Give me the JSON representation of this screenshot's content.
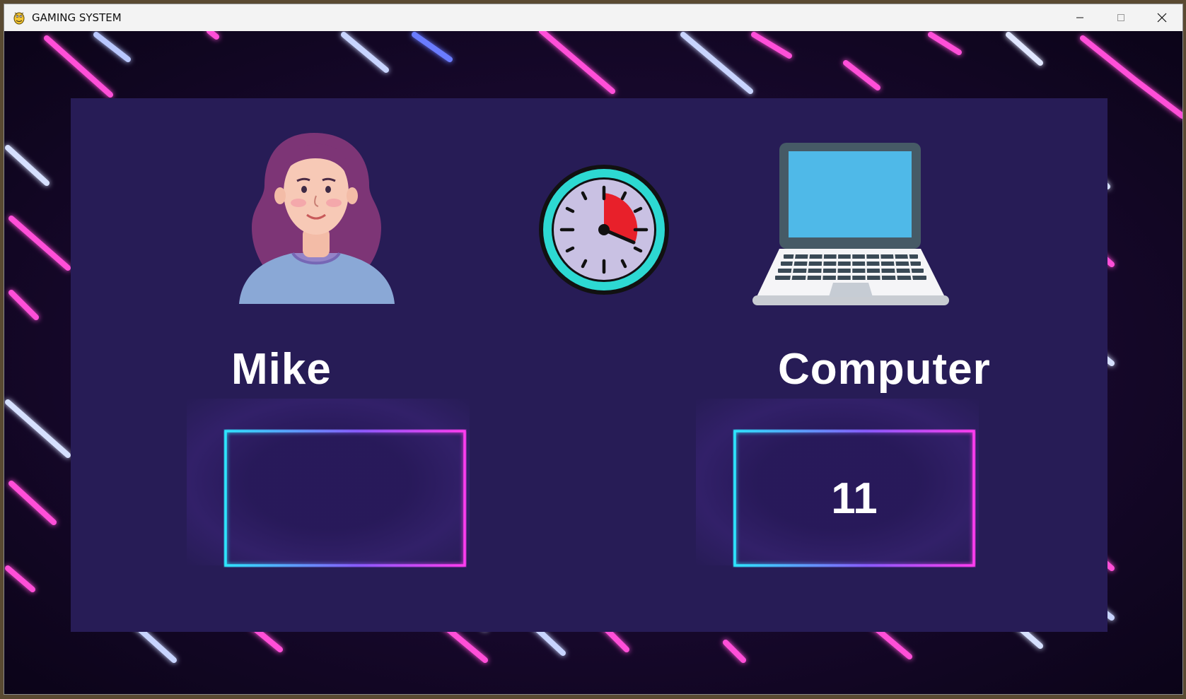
{
  "window": {
    "title": "GAMING SYSTEM",
    "controls": [
      "minimize",
      "maximize",
      "close"
    ]
  },
  "players": {
    "left": {
      "name": "Mike",
      "avatar": "woman-avatar",
      "score": ""
    },
    "right": {
      "name": "Computer",
      "avatar": "laptop-icon",
      "score": "11"
    }
  },
  "timer": {
    "icon": "stopwatch-icon"
  },
  "colors": {
    "panel": "#271c56",
    "neon_cyan": "#2ee6ff",
    "neon_magenta": "#ff3df0",
    "clock_ring": "#2dd9d2",
    "clock_face": "#c9c1e3",
    "clock_wedge": "#e8202a"
  }
}
